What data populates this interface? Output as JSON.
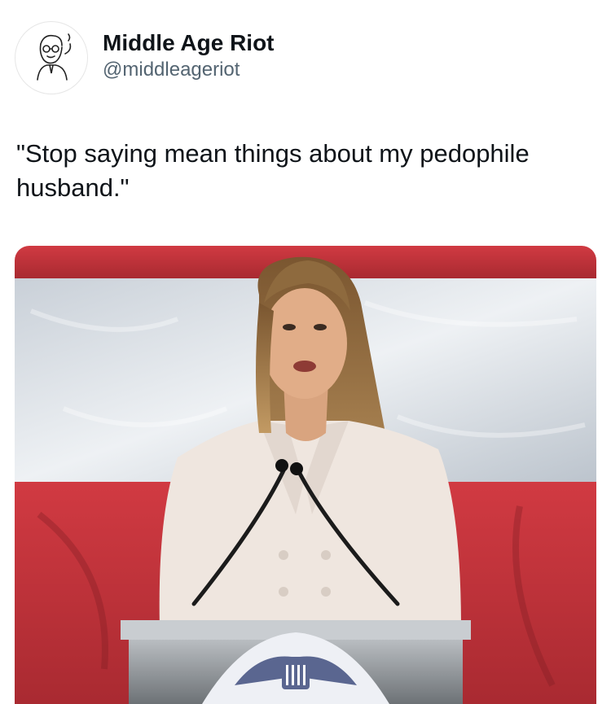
{
  "author": {
    "display_name": "Middle Age Riot",
    "handle": "@middleageriot",
    "avatar_icon": "vintage-man-cartoon-avatar"
  },
  "post": {
    "text": "\"Stop saying mean things about my pedophile husband.\""
  },
  "media": {
    "description_icon": "photo-speaker-at-podium",
    "colors": {
      "flag_red": "#c8343c",
      "flag_white": "#d8dde3",
      "jacket": "#efe6df",
      "hair": "#b08a55",
      "podium": "#8d9296"
    }
  }
}
